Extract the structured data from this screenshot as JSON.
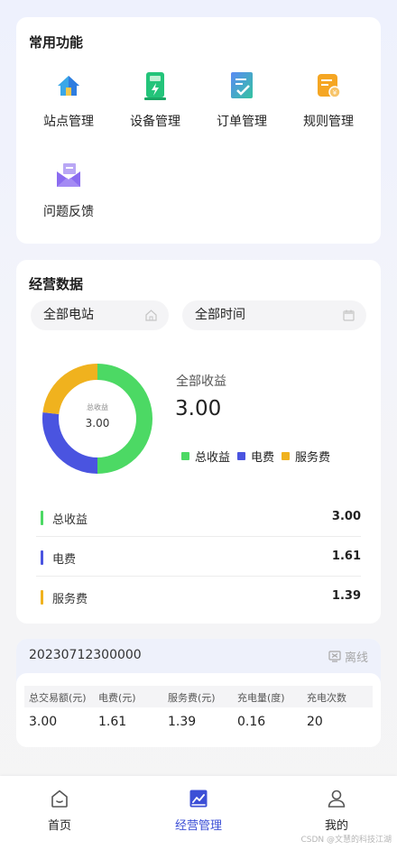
{
  "functions": {
    "title": "常用功能",
    "items": [
      {
        "label": "站点管理",
        "icon": "house-icon"
      },
      {
        "label": "设备管理",
        "icon": "charger-icon"
      },
      {
        "label": "订单管理",
        "icon": "order-icon"
      },
      {
        "label": "规则管理",
        "icon": "rule-icon"
      },
      {
        "label": "问题反馈",
        "icon": "feedback-icon"
      }
    ]
  },
  "business": {
    "title": "经营数据",
    "station_filter": "全部电站",
    "time_filter": "全部时间",
    "donut": {
      "center_label": "总收益",
      "center_value": "3.00"
    },
    "summary_label": "全部收益",
    "summary_value": "3.00",
    "legend": [
      {
        "label": "总收益",
        "color": "#4cd964"
      },
      {
        "label": "电费",
        "color": "#4a54e0"
      },
      {
        "label": "服务费",
        "color": "#f0b21e"
      }
    ],
    "stats": [
      {
        "label": "总收益",
        "value": "3.00",
        "color": "#4cd964"
      },
      {
        "label": "电费",
        "value": "1.61",
        "color": "#4a54e0"
      },
      {
        "label": "服务费",
        "value": "1.39",
        "color": "#f0b21e"
      }
    ]
  },
  "chart_data": {
    "type": "pie",
    "categories": [
      "总收益",
      "电费",
      "服务费"
    ],
    "values": [
      3.0,
      1.61,
      1.39
    ],
    "colors": [
      "#4cd964",
      "#4a54e0",
      "#f0b21e"
    ],
    "center_label": "总收益",
    "center_value": "3.00",
    "legend_position": "right"
  },
  "station": {
    "id": "20230712300000",
    "status": "离线",
    "headers": [
      "总交易额(元)",
      "电费(元)",
      "服务费(元)",
      "充电量(度)",
      "充电次数"
    ],
    "values": [
      "3.00",
      "1.61",
      "1.39",
      "0.16",
      "20"
    ]
  },
  "nav": {
    "items": [
      {
        "label": "首页",
        "icon": "home-icon"
      },
      {
        "label": "经营管理",
        "icon": "chart-icon"
      },
      {
        "label": "我的",
        "icon": "user-icon"
      }
    ],
    "active": "经营管理",
    "active_color": "#3c4fd6"
  },
  "watermark": "CSDN @文慧的科技江湖"
}
